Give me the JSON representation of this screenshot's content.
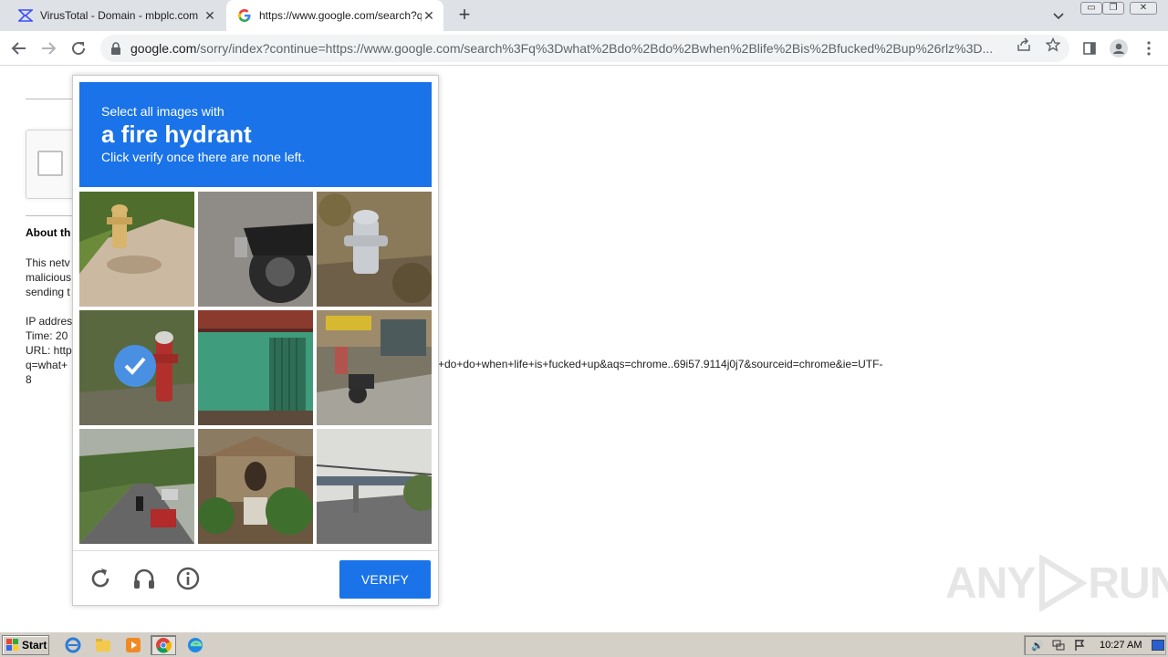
{
  "browser": {
    "tabs": [
      {
        "title": "VirusTotal - Domain - mbplc.com",
        "favicon": "virustotal-icon",
        "active": false
      },
      {
        "title": "https://www.google.com/search?q=",
        "favicon": "google-icon",
        "active": true
      }
    ],
    "new_tab_label": "+",
    "address": {
      "host": "google.com",
      "path": "/sorry/index?continue=https://www.google.com/search%3Fq%3Dwhat%2Bdo%2Bdo%2Bwhen%2Blife%2Bis%2Bfucked%2Bup%26rlz%3D..."
    }
  },
  "page": {
    "about_heading": "About th",
    "paragraph_lines": [
      "This netv",
      "malicious",
      "sending t"
    ],
    "info_lines": [
      "IP addres",
      "Time: 20",
      "URL: http",
      "q=what+",
      "8"
    ],
    "url_continuation": "+do+do+when+life+is+fucked+up&aqs=chrome..69i57.9114j0j7&sourceid=chrome&ie=UTF-"
  },
  "captcha": {
    "instruction_line1": "Select all images with",
    "instruction_target": "a fire hydrant",
    "instruction_line3": "Click verify once there are none left.",
    "verify_label": "VERIFY",
    "tiles": [
      {
        "name": "hydrant-yellow",
        "selected": false
      },
      {
        "name": "scooter-wheel",
        "selected": false
      },
      {
        "name": "hydrant-grey",
        "selected": false
      },
      {
        "name": "hydrant-red",
        "selected": true
      },
      {
        "name": "green-wall",
        "selected": false
      },
      {
        "name": "street-shops",
        "selected": false
      },
      {
        "name": "road-traffic",
        "selected": false
      },
      {
        "name": "house-porch",
        "selected": false
      },
      {
        "name": "bridge-road",
        "selected": false
      }
    ],
    "accent_color": "#1a73e8"
  },
  "watermark": {
    "text_left": "ANY",
    "text_right": "RUN"
  },
  "taskbar": {
    "start_label": "Start",
    "clock": "10:27 AM",
    "apps": [
      "ie-icon",
      "explorer-icon",
      "media-player-icon",
      "chrome-icon",
      "edge-icon"
    ]
  }
}
